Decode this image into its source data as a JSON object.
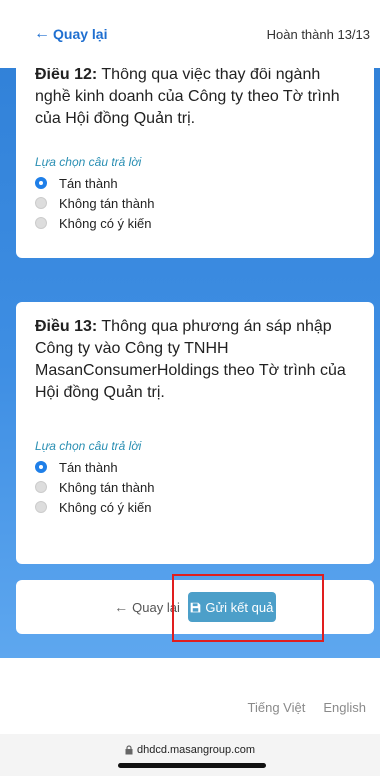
{
  "topbar": {
    "back_label": "Quay lại",
    "progress": "Hoàn thành 13/13"
  },
  "questions": [
    {
      "prefix": "Điều 12:",
      "text": " Thông qua việc thay đổi ngành nghề kinh doanh của Công ty theo Tờ trình của Hội đồng Quản trị.",
      "choice_label": "Lựa chọn câu trả lời",
      "options": [
        "Tán thành",
        "Không tán thành",
        "Không có ý kiến"
      ],
      "selected": "Tán thành"
    },
    {
      "prefix": "Điều 13:",
      "text": " Thông qua phương án sáp nhập Công ty vào Công ty TNHH MasanConsumerHoldings theo Tờ trình của Hội đồng Quản trị.",
      "choice_label": "Lựa chọn câu trả lời",
      "options": [
        "Tán thành",
        "Không tán thành",
        "Không có ý kiến"
      ],
      "selected": "Tán thành"
    }
  ],
  "actions": {
    "back_label": "Quay lại",
    "submit_label": "Gửi kết quả"
  },
  "languages": [
    "Tiếng Việt",
    "English"
  ],
  "browser": {
    "url": "dhdcd.masangroup.com"
  },
  "colors": {
    "accent": "#1f6fd0",
    "submit": "#4c9fc9",
    "highlight": "#e01e1e"
  },
  "icons": {
    "back": "arrow-left-icon",
    "submit": "floppy-disk-icon",
    "lock": "lock-icon"
  }
}
